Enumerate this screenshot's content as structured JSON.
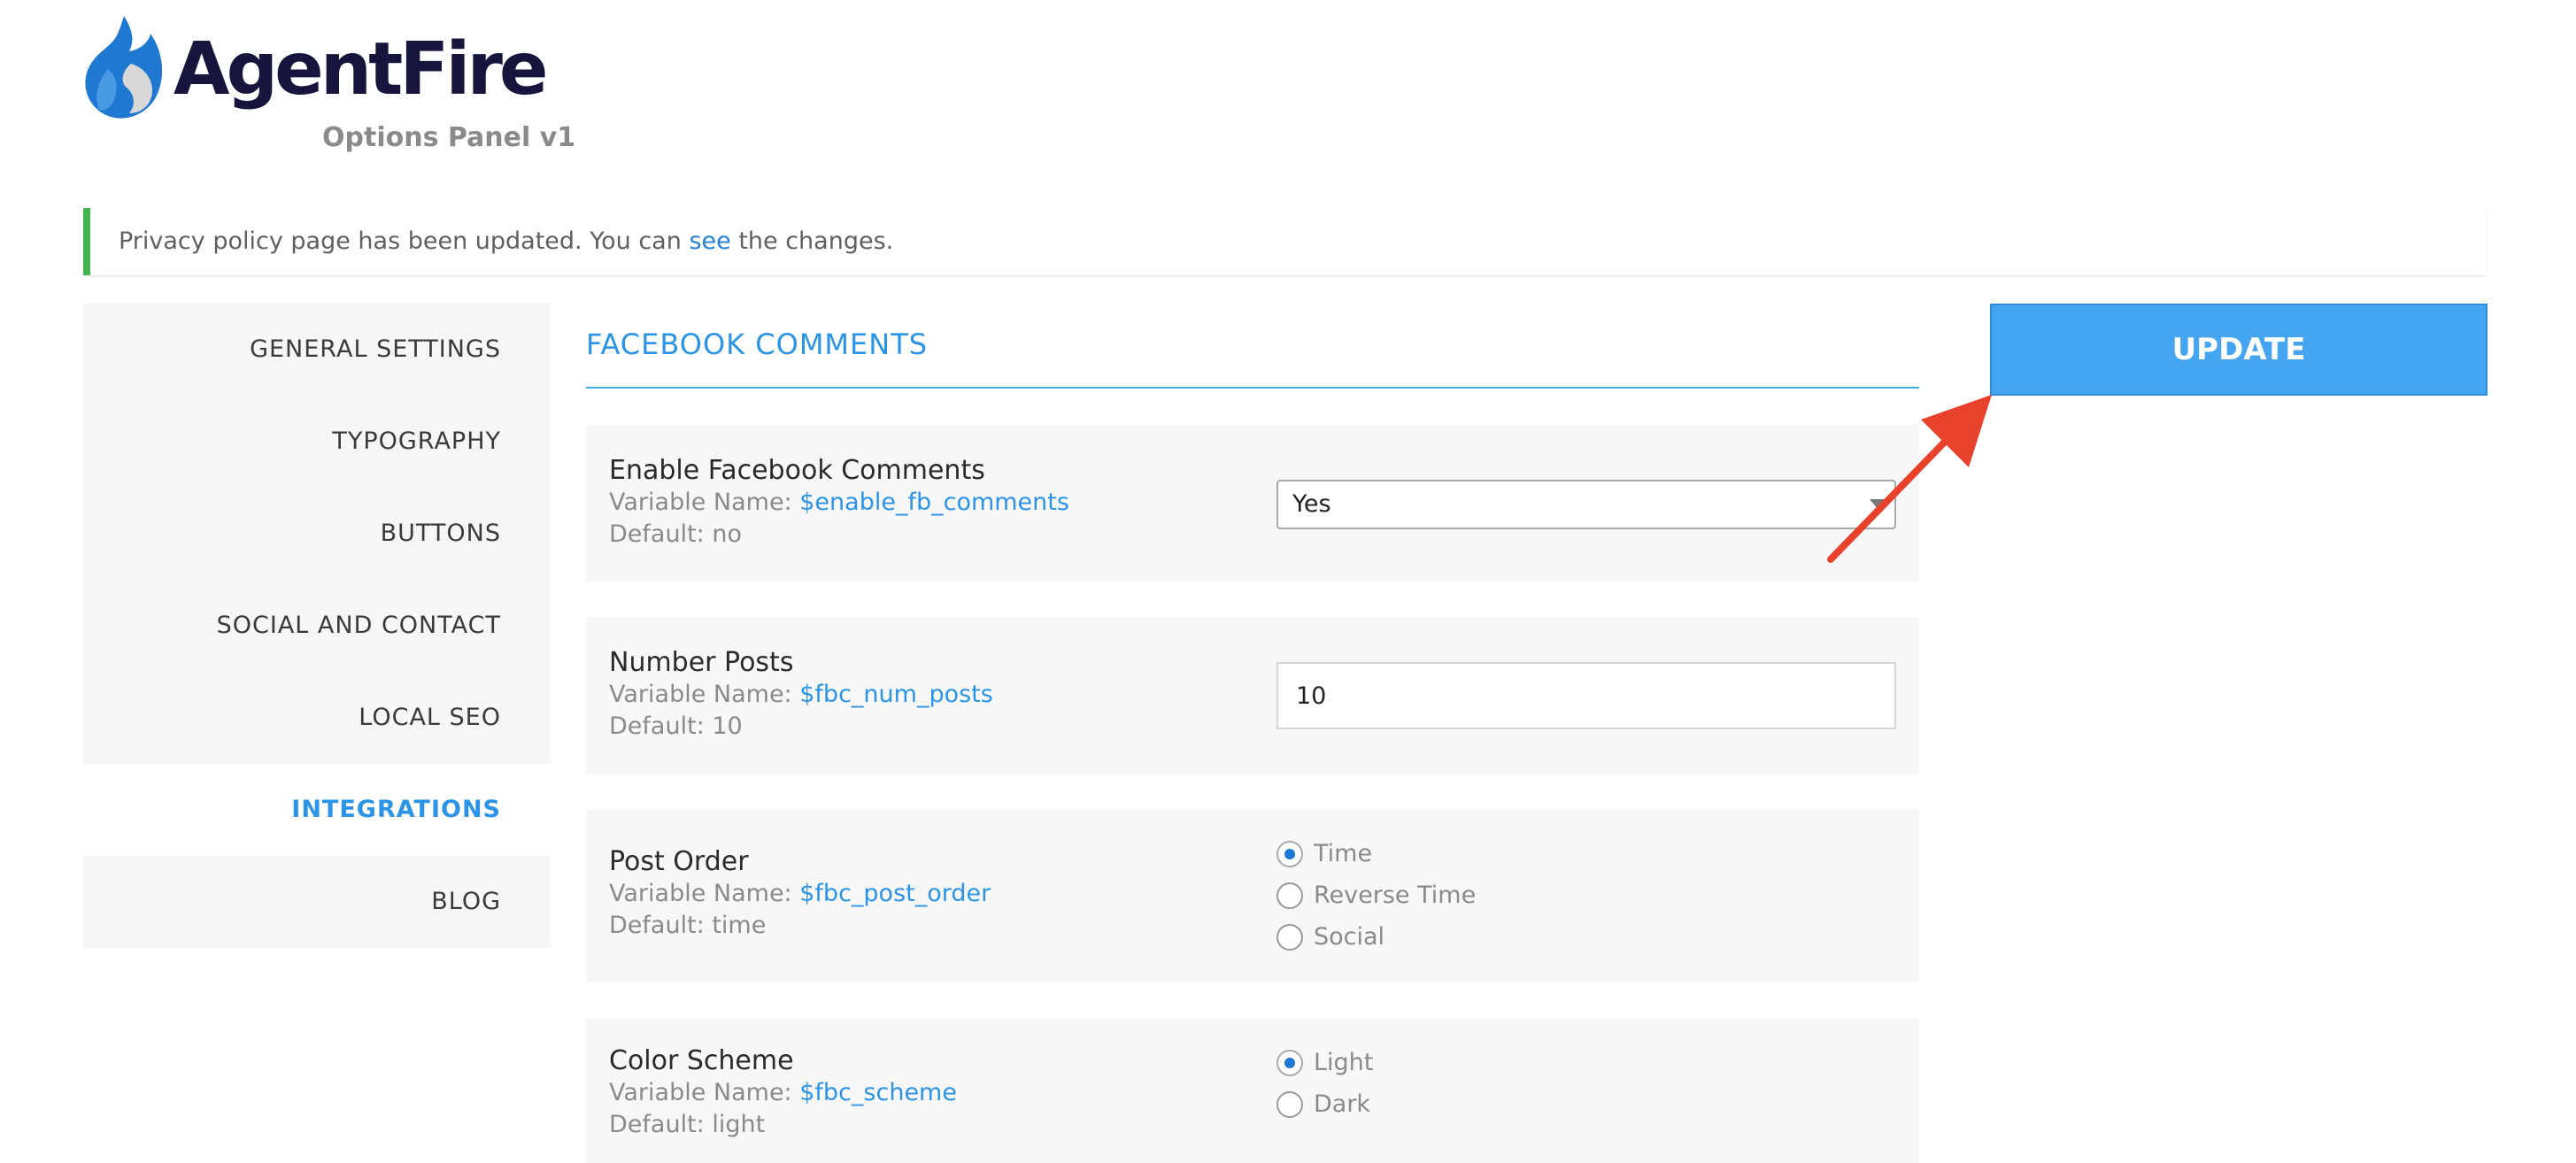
{
  "logo": {
    "name": "AgentFire",
    "subtitle": "Options Panel v1"
  },
  "notice": {
    "text_before": "Privacy policy page has been updated. You can ",
    "link_text": "see",
    "text_after": " the changes.",
    "accent_color": "#46b450"
  },
  "sidebar": {
    "items": [
      {
        "label": "GENERAL SETTINGS",
        "active": false
      },
      {
        "label": "TYPOGRAPHY",
        "active": false
      },
      {
        "label": "BUTTONS",
        "active": false
      },
      {
        "label": "SOCIAL AND CONTACT",
        "active": false
      },
      {
        "label": "LOCAL SEO",
        "active": false
      },
      {
        "label": "INTEGRATIONS",
        "active": true
      },
      {
        "label": "BLOG",
        "active": false
      }
    ]
  },
  "section": {
    "title": "FACEBOOK COMMENTS"
  },
  "labels": {
    "variable_prefix": "Variable Name: ",
    "default_prefix": "Default: "
  },
  "options": [
    {
      "title": "Enable Facebook Comments",
      "variable": "$enable_fb_comments",
      "default": "no",
      "control": "select",
      "value": "Yes"
    },
    {
      "title": "Number Posts",
      "variable": "$fbc_num_posts",
      "default": "10",
      "control": "text",
      "value": "10"
    },
    {
      "title": "Post Order",
      "variable": "$fbc_post_order",
      "default": "time",
      "control": "radio",
      "choices": [
        "Time",
        "Reverse Time",
        "Social"
      ],
      "selected": "Time"
    },
    {
      "title": "Color Scheme",
      "variable": "$fbc_scheme",
      "default": "light",
      "control": "radio",
      "choices": [
        "Light",
        "Dark"
      ],
      "selected": "Light"
    }
  ],
  "update_button": {
    "label": "UPDATE"
  },
  "colors": {
    "accent": "#2b94e6",
    "button": "#45a5f0",
    "annotation_arrow": "#e8412c",
    "logo_dark": "#15153d"
  },
  "icons": {
    "logo": "flame-icon",
    "select_caret": "chevron-down-icon",
    "annotation": "arrow-icon"
  }
}
